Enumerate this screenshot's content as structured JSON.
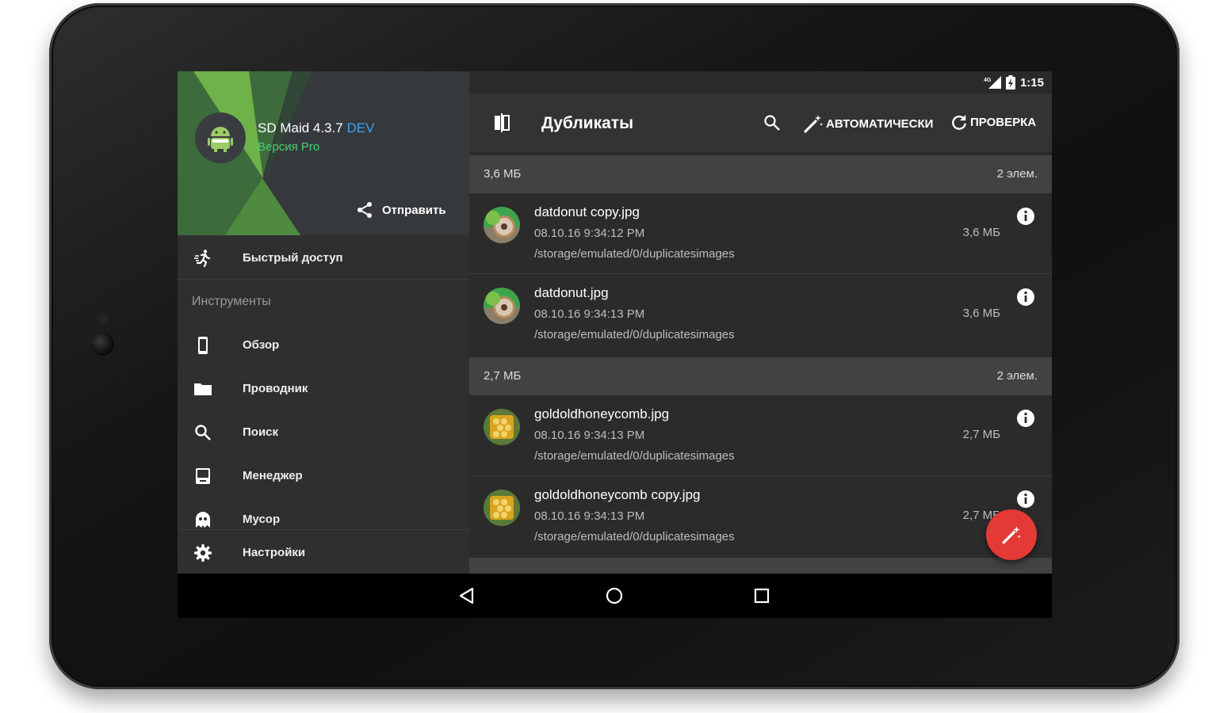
{
  "status": {
    "network": "4G",
    "time": "1:15"
  },
  "drawer": {
    "app_name": "SD Maid 4.3.7",
    "app_channel": "DEV",
    "app_edition": "Версия Pro",
    "share_label": "Отправить",
    "quick_access": "Быстрый доступ",
    "tools_section": "Инструменты",
    "items": [
      {
        "label": "Обзор",
        "icon": "phone-icon"
      },
      {
        "label": "Проводник",
        "icon": "folder-icon"
      },
      {
        "label": "Поиск",
        "icon": "search-icon"
      },
      {
        "label": "Менеджер",
        "icon": "app-manager-icon"
      },
      {
        "label": "Мусор",
        "icon": "ghost-icon"
      }
    ],
    "settings": "Настройки"
  },
  "toolbar": {
    "title": "Дубликаты",
    "auto_label": "АВТОМАТИЧЕСКИ",
    "check_label": "ПРОВЕРКА"
  },
  "groups": [
    {
      "size": "3,6 МБ",
      "count": "2 элем.",
      "files": [
        {
          "name": "datdonut copy.jpg",
          "date": "08.10.16 9:34:12 PM",
          "path": "/storage/emulated/0/duplicatesimages",
          "size": "3,6 МБ"
        },
        {
          "name": "datdonut.jpg",
          "date": "08.10.16 9:34:13 PM",
          "path": "/storage/emulated/0/duplicatesimages",
          "size": "3,6 МБ"
        }
      ]
    },
    {
      "size": "2,7 МБ",
      "count": "2 элем.",
      "files": [
        {
          "name": "goldoldhoneycomb.jpg",
          "date": "08.10.16 9:34:13 PM",
          "path": "/storage/emulated/0/duplicatesimages",
          "size": "2,7 МБ"
        },
        {
          "name": "goldoldhoneycomb copy.jpg",
          "date": "08.10.16 9:34:13 PM",
          "path": "/storage/emulated/0/duplicatesimages",
          "size": "2,7 МБ"
        }
      ]
    }
  ],
  "colors": {
    "accent": "#e53935",
    "dev": "#3aa3f5",
    "pro": "#49d16b"
  }
}
